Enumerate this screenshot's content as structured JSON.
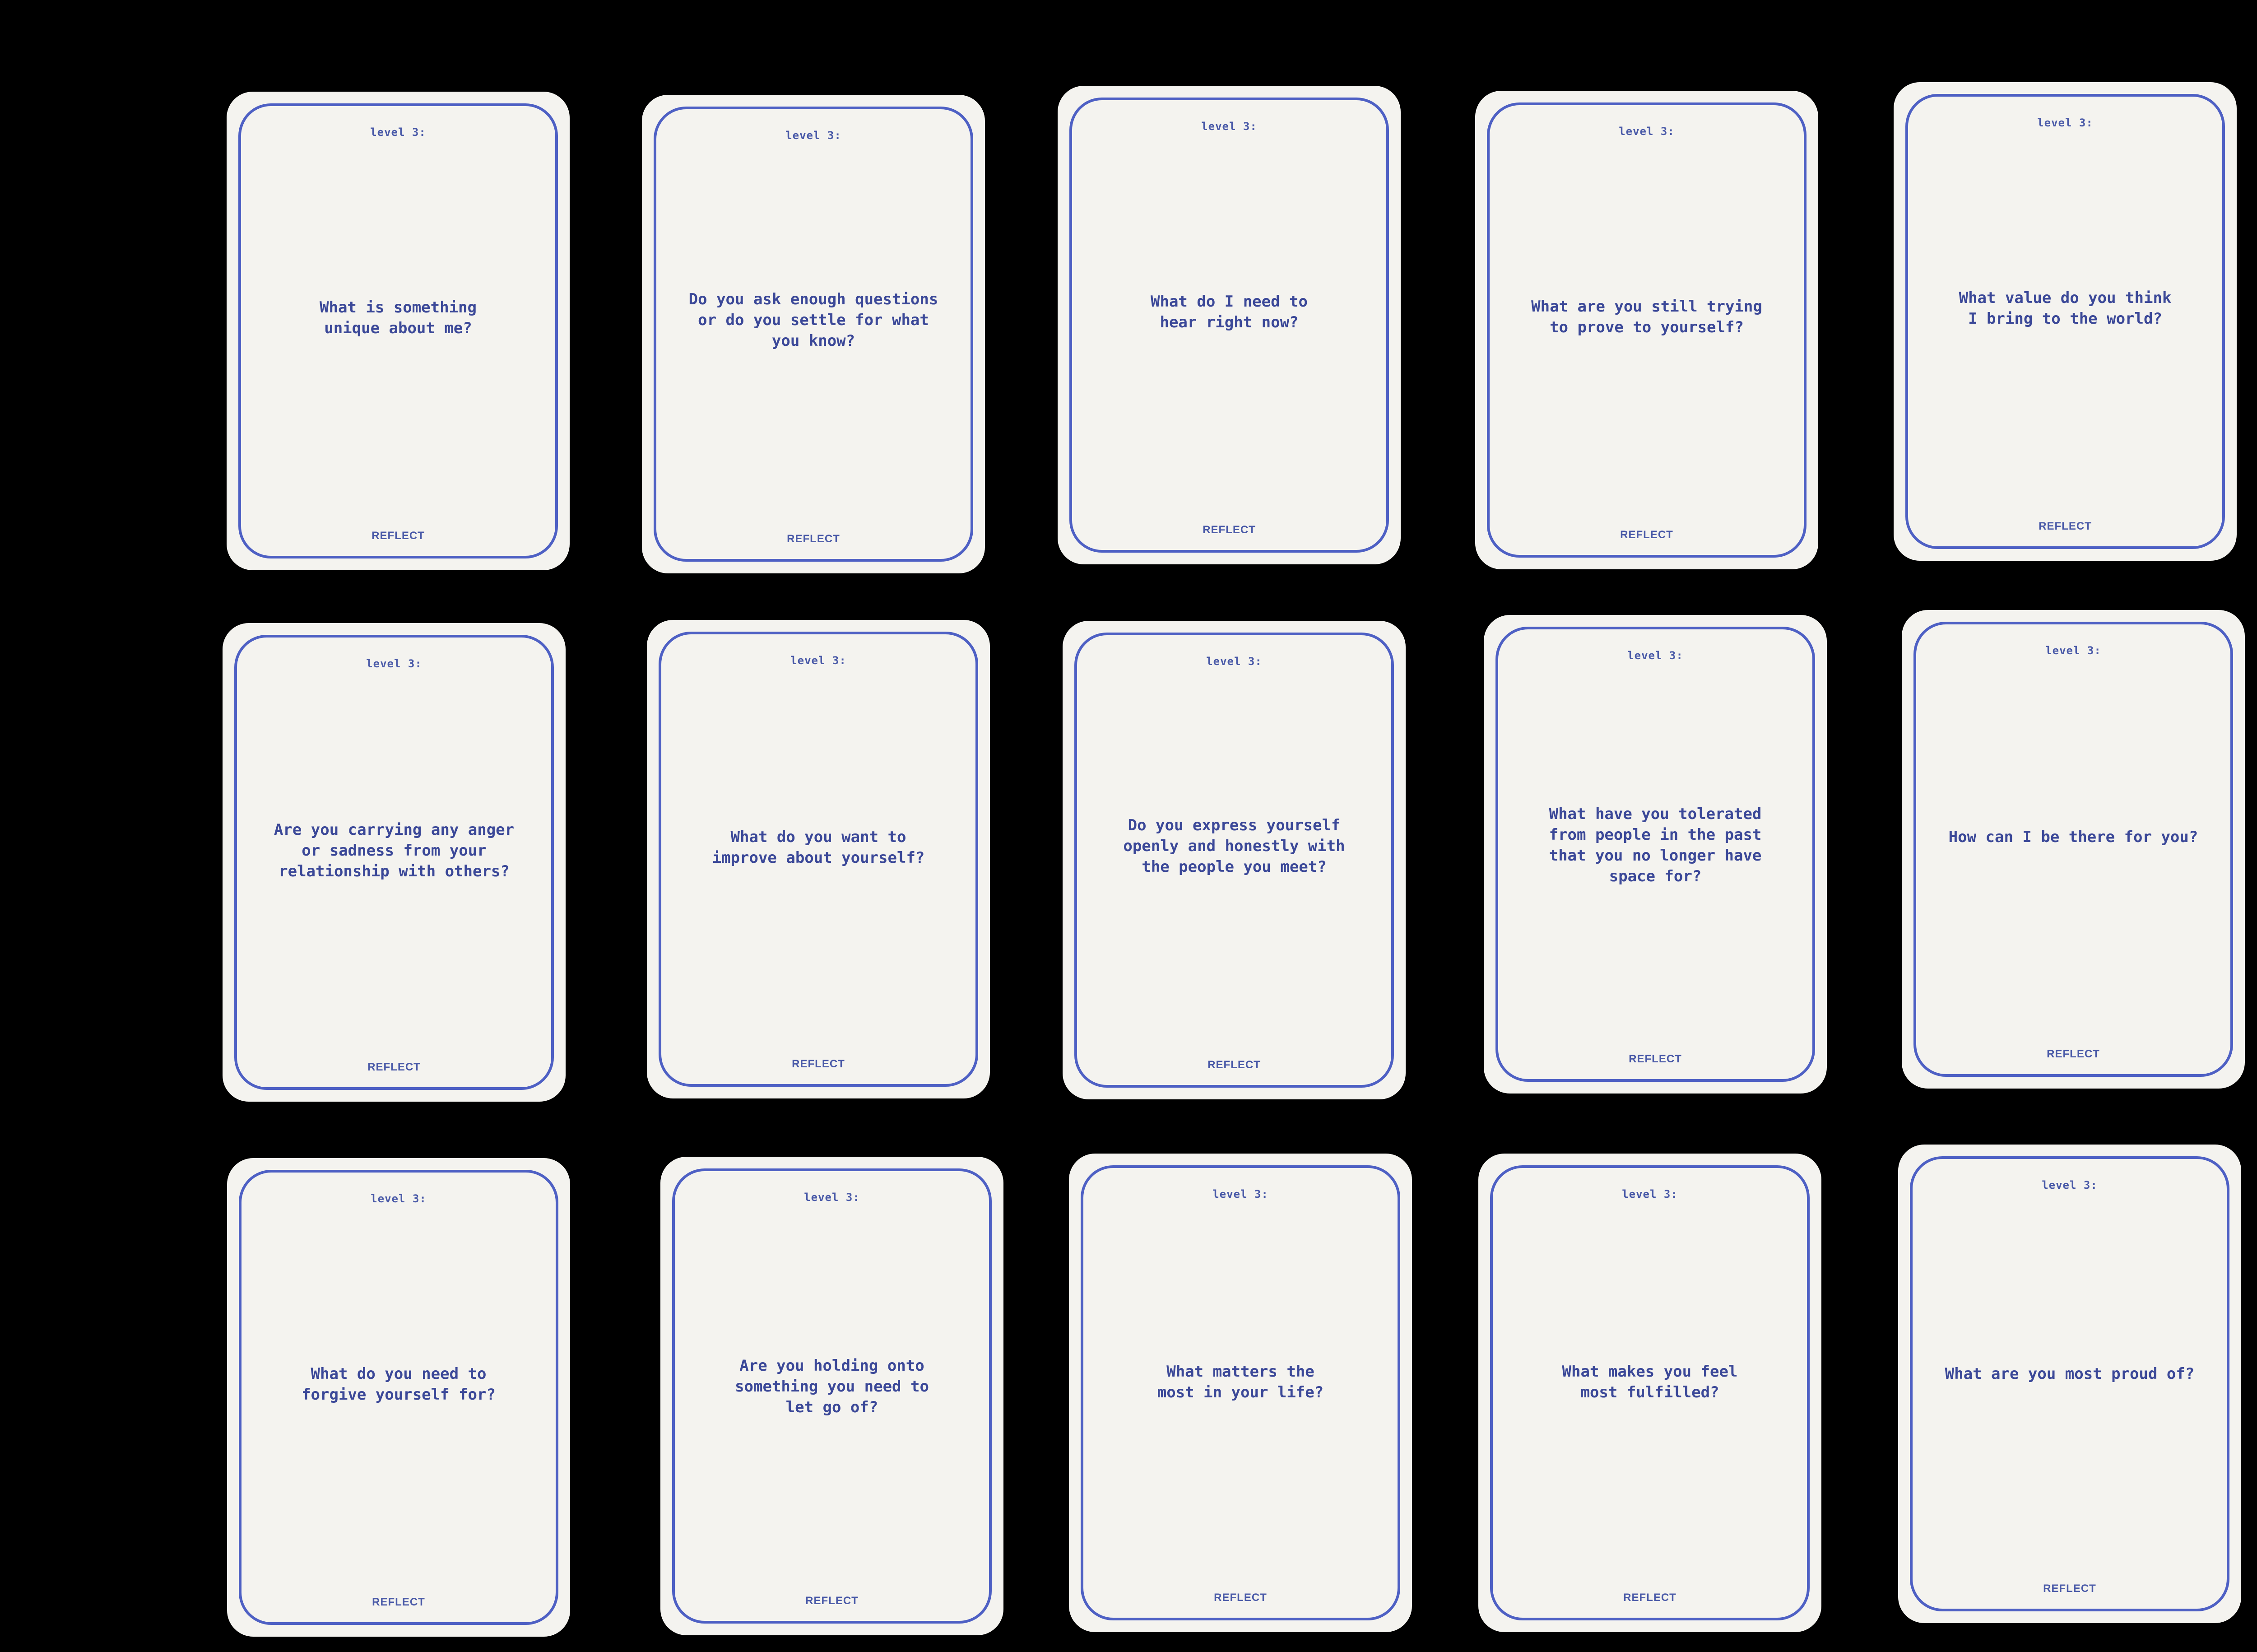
{
  "cards": [
    {
      "level": "level 3:",
      "question": "What is something\nunique about me?",
      "footer": "REFLECT"
    },
    {
      "level": "level 3:",
      "question": "Do you ask enough questions\nor do you settle for what\nyou know?",
      "footer": "REFLECT"
    },
    {
      "level": "level 3:",
      "question": "What do I need to\nhear right now?",
      "footer": "REFLECT"
    },
    {
      "level": "level 3:",
      "question": "What are you still trying\nto prove to yourself?",
      "footer": "REFLECT"
    },
    {
      "level": "level 3:",
      "question": "What value do you think\nI bring to the world?",
      "footer": "REFLECT"
    },
    {
      "level": "level 3:",
      "question": "Are you carrying any anger\nor sadness from your\nrelationship with others?",
      "footer": "REFLECT"
    },
    {
      "level": "level 3:",
      "question": "What do you want to\nimprove about yourself?",
      "footer": "REFLECT"
    },
    {
      "level": "level 3:",
      "question": "Do you express yourself\nopenly and honestly with\nthe people you meet?",
      "footer": "REFLECT"
    },
    {
      "level": "level 3:",
      "question": "What have you tolerated\nfrom people in the past\nthat you no longer have\nspace for?",
      "footer": "REFLECT"
    },
    {
      "level": "level 3:",
      "question": "How can I be there for you?",
      "footer": "REFLECT"
    },
    {
      "level": "level 3:",
      "question": "What do you need to\nforgive yourself for?",
      "footer": "REFLECT"
    },
    {
      "level": "level 3:",
      "question": "Are you holding onto\nsomething you need to\nlet go of?",
      "footer": "REFLECT"
    },
    {
      "level": "level 3:",
      "question": "What matters the\nmost in your life?",
      "footer": "REFLECT"
    },
    {
      "level": "level 3:",
      "question": "What makes you feel\nmost fulfilled?",
      "footer": "REFLECT"
    },
    {
      "level": "level 3:",
      "question": "What are you most proud of?",
      "footer": "REFLECT"
    }
  ],
  "colors": {
    "background": "#000000",
    "card": "#f4f3ef",
    "frame": "#4e60c4",
    "text": "#3b4898"
  }
}
